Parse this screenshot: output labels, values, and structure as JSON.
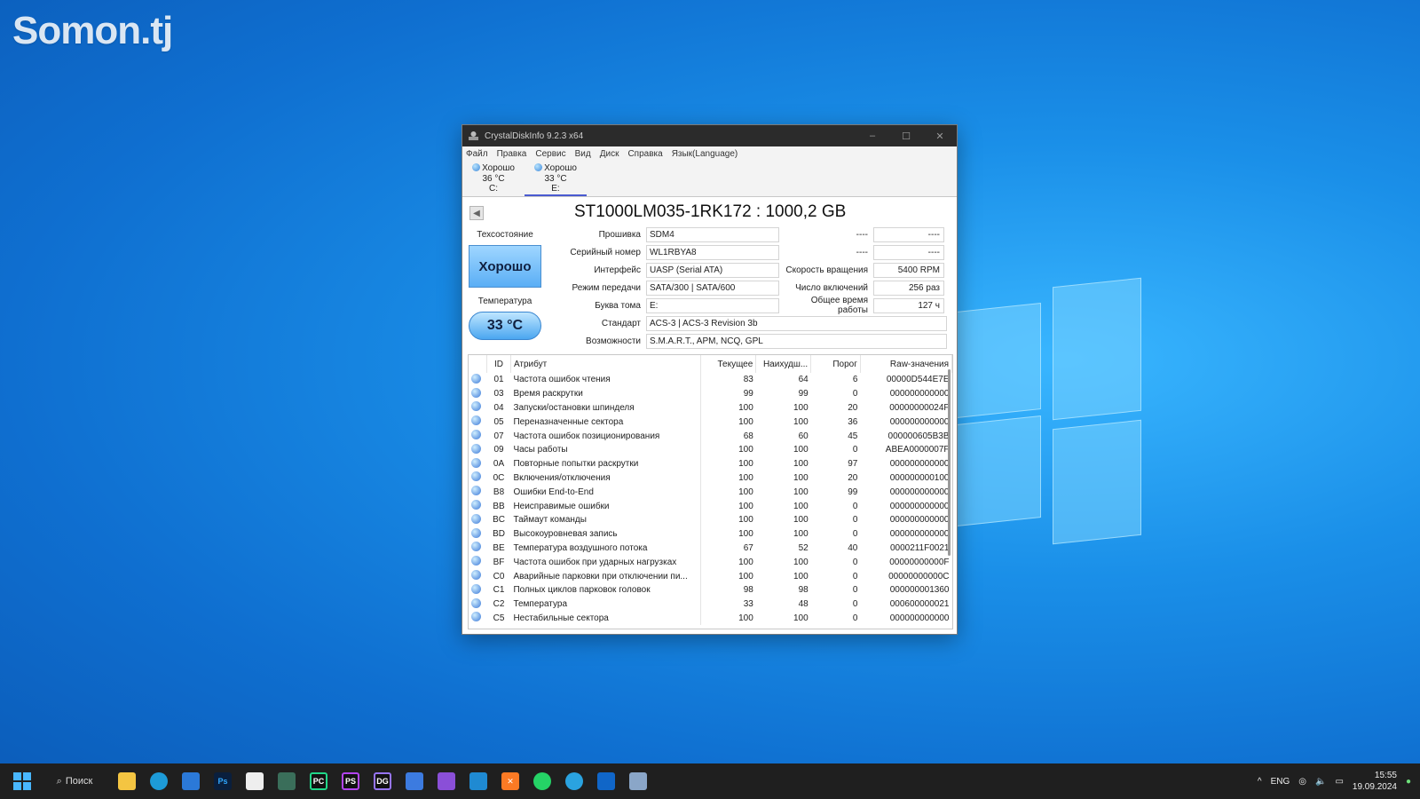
{
  "watermark": "Somon.tj",
  "window": {
    "title": "CrystalDiskInfo 9.2.3 x64",
    "controls": {
      "minimize": "–",
      "maximize": "☐",
      "close": "✕"
    }
  },
  "menu": [
    "Файл",
    "Правка",
    "Сервис",
    "Вид",
    "Диск",
    "Справка",
    "Язык(Language)"
  ],
  "disk_tabs": [
    {
      "status": "Хорошо",
      "temp": "36 °C",
      "letter": "C:"
    },
    {
      "status": "Хорошо",
      "temp": "33 °C",
      "letter": "E:"
    }
  ],
  "drive": {
    "title": "ST1000LM035-1RK172 : 1000,2 GB"
  },
  "health": {
    "label": "Техсостояние",
    "value": "Хорошо",
    "color": "#5aaef5"
  },
  "temperature": {
    "label": "Температура",
    "value": "33 °C"
  },
  "info": {
    "firmware_label": "Прошивка",
    "firmware": "SDM4",
    "serial_label": "Серийный номер",
    "serial": "WL1RBYA8",
    "interface_label": "Интерфейс",
    "interface": "UASP (Serial ATA)",
    "transfer_label": "Режим передачи",
    "transfer": "SATA/300 | SATA/600",
    "volume_label": "Буква тома",
    "volume": "E:",
    "standard_label": "Стандарт",
    "standard": "ACS-3 | ACS-3 Revision 3b",
    "features_label": "Возможности",
    "features": "S.M.A.R.T., APM, NCQ, GPL",
    "blank1_label": "----",
    "blank1": "----",
    "blank2_label": "----",
    "blank2": "----",
    "rotation_label": "Скорость вращения",
    "rotation": "5400 RPM",
    "power_on_count_label": "Число включений",
    "power_on_count": "256 раз",
    "power_on_hours_label": "Общее время работы",
    "power_on_hours": "127 ч"
  },
  "smart": {
    "headers": {
      "id": "ID",
      "attribute": "Атрибут",
      "current": "Текущее",
      "worst": "Наихудш...",
      "threshold": "Порог",
      "raw": "Raw-значения"
    },
    "rows": [
      {
        "id": "01",
        "attribute": "Частота ошибок чтения",
        "current": "83",
        "worst": "64",
        "threshold": "6",
        "raw": "00000D544E7E"
      },
      {
        "id": "03",
        "attribute": "Время раскрутки",
        "current": "99",
        "worst": "99",
        "threshold": "0",
        "raw": "000000000000"
      },
      {
        "id": "04",
        "attribute": "Запуски/остановки шпинделя",
        "current": "100",
        "worst": "100",
        "threshold": "20",
        "raw": "00000000024F"
      },
      {
        "id": "05",
        "attribute": "Переназначенные сектора",
        "current": "100",
        "worst": "100",
        "threshold": "36",
        "raw": "000000000000"
      },
      {
        "id": "07",
        "attribute": "Частота ошибок позиционирования",
        "current": "68",
        "worst": "60",
        "threshold": "45",
        "raw": "000000605B3B"
      },
      {
        "id": "09",
        "attribute": "Часы работы",
        "current": "100",
        "worst": "100",
        "threshold": "0",
        "raw": "ABEA0000007F"
      },
      {
        "id": "0A",
        "attribute": "Повторные попытки раскрутки",
        "current": "100",
        "worst": "100",
        "threshold": "97",
        "raw": "000000000000"
      },
      {
        "id": "0C",
        "attribute": "Включения/отключения",
        "current": "100",
        "worst": "100",
        "threshold": "20",
        "raw": "000000000100"
      },
      {
        "id": "B8",
        "attribute": "Ошибки End-to-End",
        "current": "100",
        "worst": "100",
        "threshold": "99",
        "raw": "000000000000"
      },
      {
        "id": "BB",
        "attribute": "Неисправимые ошибки",
        "current": "100",
        "worst": "100",
        "threshold": "0",
        "raw": "000000000000"
      },
      {
        "id": "BC",
        "attribute": "Таймаут команды",
        "current": "100",
        "worst": "100",
        "threshold": "0",
        "raw": "000000000000"
      },
      {
        "id": "BD",
        "attribute": "Высокоуровневая запись",
        "current": "100",
        "worst": "100",
        "threshold": "0",
        "raw": "000000000000"
      },
      {
        "id": "BE",
        "attribute": "Температура воздушного потока",
        "current": "67",
        "worst": "52",
        "threshold": "40",
        "raw": "0000211F0021"
      },
      {
        "id": "BF",
        "attribute": "Частота ошибок при ударных нагрузках",
        "current": "100",
        "worst": "100",
        "threshold": "0",
        "raw": "00000000000F"
      },
      {
        "id": "C0",
        "attribute": "Аварийные парковки при отключении пи...",
        "current": "100",
        "worst": "100",
        "threshold": "0",
        "raw": "00000000000C"
      },
      {
        "id": "C1",
        "attribute": "Полных циклов парковок головок",
        "current": "98",
        "worst": "98",
        "threshold": "0",
        "raw": "000000001360"
      },
      {
        "id": "C2",
        "attribute": "Температура",
        "current": "33",
        "worst": "48",
        "threshold": "0",
        "raw": "000600000021"
      },
      {
        "id": "C5",
        "attribute": "Нестабильные сектора",
        "current": "100",
        "worst": "100",
        "threshold": "0",
        "raw": "000000000000"
      }
    ]
  },
  "taskbar": {
    "search_label": "Поиск",
    "apps": [
      "start-menu",
      "file-explorer",
      "edge",
      "store",
      "photoshop",
      "capcut",
      "terminal",
      "pycharm",
      "phpstorm",
      "datagrip",
      "android-studio",
      "visual-studio",
      "vscode",
      "xampp",
      "whatsapp",
      "telegram",
      "outlook",
      "crystaldiskinfo"
    ],
    "app_glyphs": {
      "photoshop": "Ps",
      "pycharm": "PC",
      "phpstorm": "PS",
      "datagrip": "DG",
      "xampp": "✕"
    },
    "tray": {
      "lang": "ENG",
      "time": "15:55",
      "date": "19.09.2024",
      "chevron": "^"
    }
  }
}
